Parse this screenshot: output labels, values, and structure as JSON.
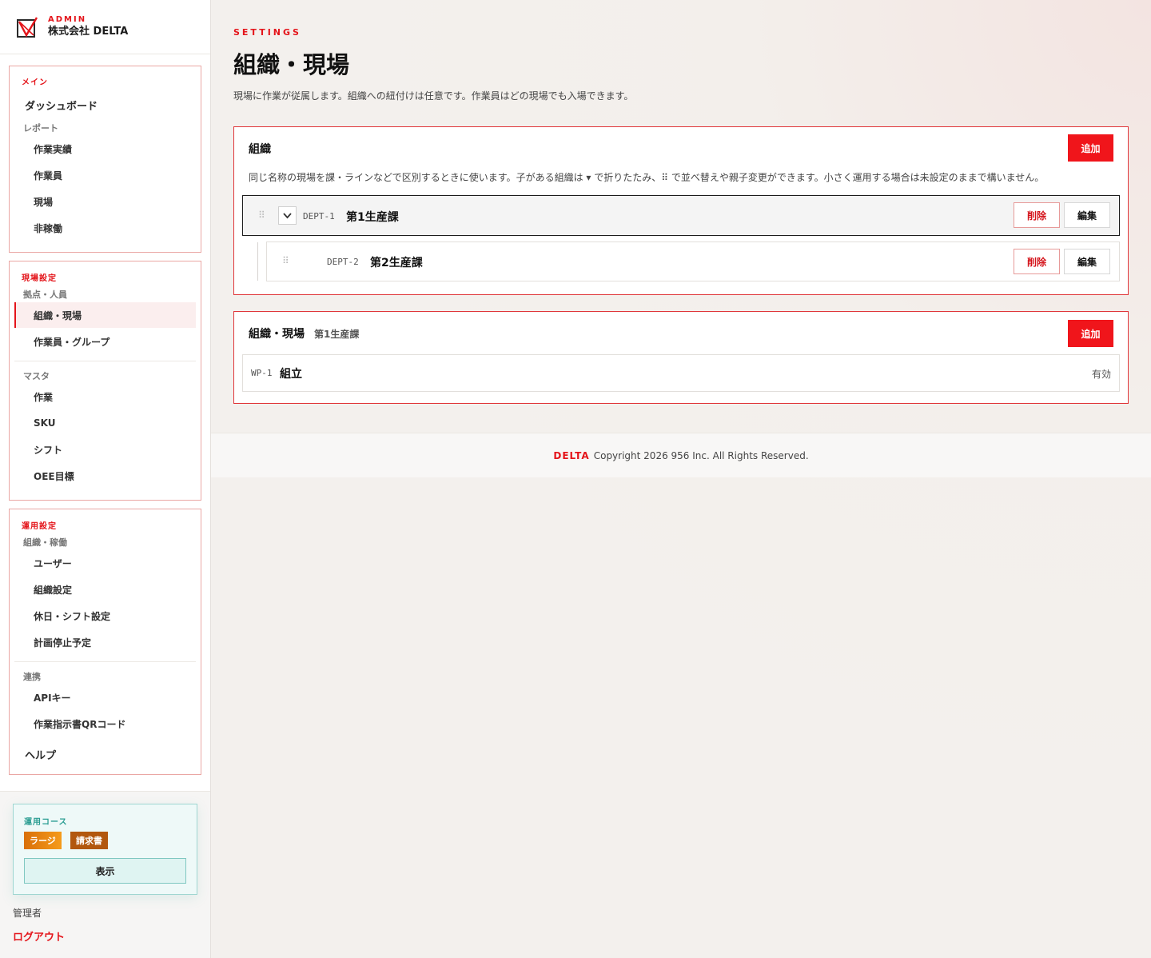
{
  "brand": {
    "admin": "ADMIN",
    "company": "株式会社 DELTA"
  },
  "sidebar": {
    "main": {
      "title": "メイン",
      "dashboard": "ダッシュボード",
      "reports_group": "レポート",
      "items": [
        "作業実績",
        "作業員",
        "現場",
        "非稼働"
      ]
    },
    "site": {
      "title": "現場設定",
      "group1": "拠点・人員",
      "group1_items": [
        "組織・現場",
        "作業員・グループ"
      ],
      "group2": "マスタ",
      "group2_items": [
        "作業",
        "SKU",
        "シフト",
        "OEE目標"
      ]
    },
    "ops": {
      "title": "運用設定",
      "group1": "組織・稼働",
      "group1_items": [
        "ユーザー",
        "組織設定",
        "休日・シフト設定",
        "計画停止予定"
      ],
      "group2": "連携",
      "group2_items": [
        "APIキー",
        "作業指示書QRコード"
      ],
      "help": "ヘルプ"
    },
    "plan": {
      "title": "運用コース",
      "badges": [
        "ラージ",
        "請求書"
      ],
      "button": "表示"
    },
    "user_role": "管理者",
    "logout": "ログアウト"
  },
  "page": {
    "eyebrow": "SETTINGS",
    "title": "組織・現場",
    "description": "現場に作業が従属します。組織への紐付けは任意です。作業員はどの現場でも入場できます。"
  },
  "org_card": {
    "title": "組織",
    "add": "追加",
    "description": "同じ名称の現場を課・ラインなどで区別するときに使います。子がある組織は ▾ で折りたたみ、⠿ で並べ替えや親子変更ができます。小さく運用する場合は未設定のままで構いません。",
    "rows": [
      {
        "code": "DEPT-1",
        "name": "第1生産課",
        "delete": "削除",
        "edit": "編集"
      },
      {
        "code": "DEPT-2",
        "name": "第2生産課",
        "delete": "削除",
        "edit": "編集"
      }
    ]
  },
  "site_card": {
    "title": "組織・現場",
    "subtitle": "第1生産課",
    "add": "追加",
    "rows": [
      {
        "code": "WP-1",
        "name": "組立",
        "status": "有効"
      }
    ]
  },
  "footer": {
    "brand": "DELTA",
    "copyright": "Copyright 2026 956 Inc. All Rights Reserved."
  },
  "colors": {
    "accent": "#e4141a",
    "teal": "#2a9d92"
  }
}
